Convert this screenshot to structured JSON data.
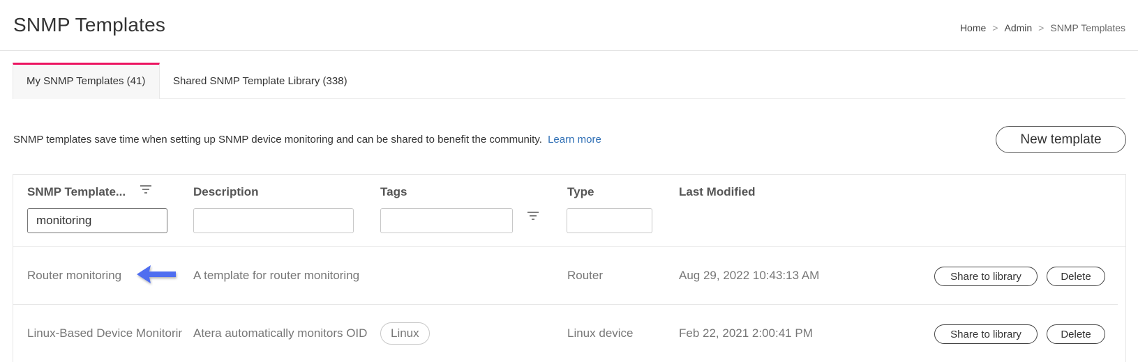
{
  "page": {
    "title": "SNMP Templates",
    "breadcrumb": [
      "Home",
      "Admin",
      "SNMP Templates"
    ],
    "breadcrumb_separator": ">"
  },
  "tabs": [
    {
      "label": "My SNMP Templates (41)",
      "active": true
    },
    {
      "label": "Shared SNMP Template Library (338)",
      "active": false
    }
  ],
  "intro": {
    "text": "SNMP templates save time when setting up SNMP device monitoring and can be shared to benefit the community.",
    "link": "Learn more"
  },
  "new_template_label": "New template",
  "table": {
    "headers": {
      "name": "SNMP Template...",
      "description": "Description",
      "tags": "Tags",
      "type": "Type",
      "modified": "Last Modified"
    },
    "filters": {
      "name": "monitoring",
      "description": "",
      "tags": "",
      "type": ""
    },
    "rows": [
      {
        "name": "Router monitoring",
        "description": "A template for router monitoring",
        "tag": "",
        "type": "Router",
        "modified": "Aug 29, 2022 10:43:13 AM",
        "share_label": "Share to library",
        "delete_label": "Delete"
      },
      {
        "name": "Linux-Based Device Monitoring",
        "description": "Atera automatically monitors OIDs",
        "tag": "Linux",
        "type": "Linux device",
        "modified": "Feb 22, 2021 2:00:41 PM",
        "share_label": "Share to library",
        "delete_label": "Delete"
      }
    ]
  },
  "colors": {
    "accent_tab": "#ec1561",
    "link": "#2f6fb5",
    "arrow": "#4f6ef0"
  },
  "icons": [
    "filter-icon",
    "arrow-left-icon"
  ]
}
